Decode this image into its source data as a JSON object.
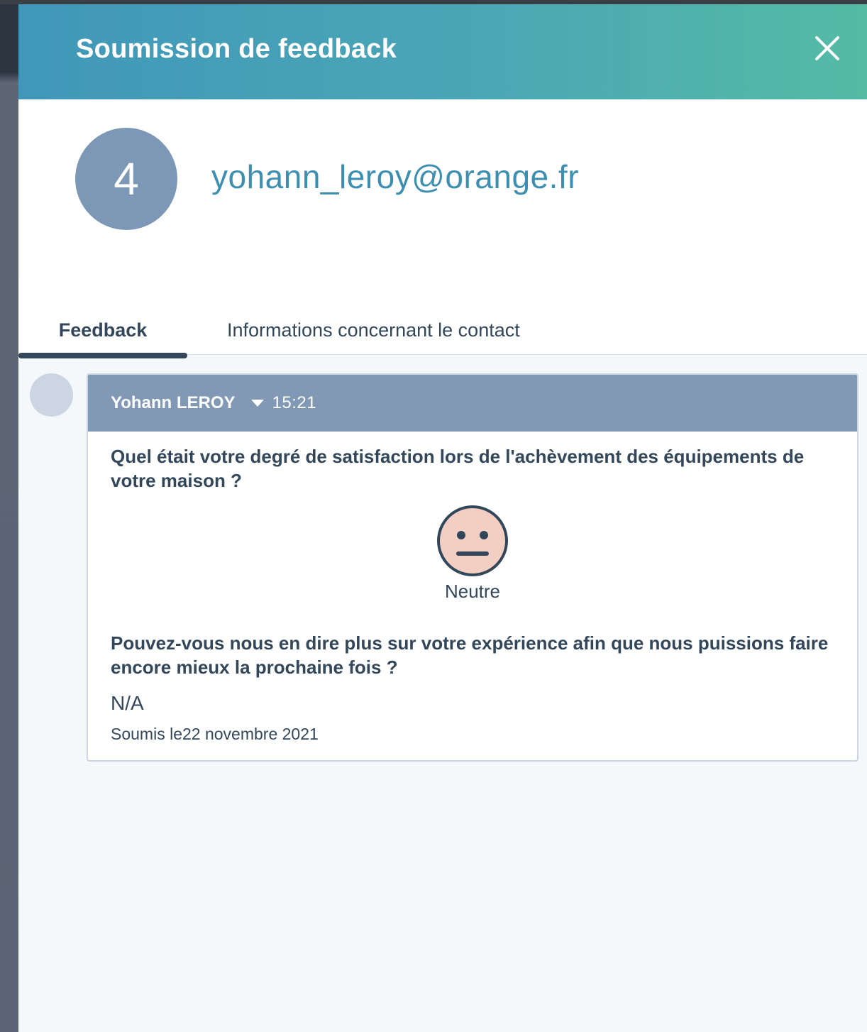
{
  "panel": {
    "title": "Soumission de feedback",
    "close_icon": "close-icon"
  },
  "contact": {
    "avatar_text": "4",
    "email": "yohann_leroy@orange.fr"
  },
  "tabs": [
    {
      "label": "Feedback",
      "active": true
    },
    {
      "label": "Informations concernant le contact",
      "active": false
    }
  ],
  "submission": {
    "author": "Yohann LEROY",
    "time": "15:21",
    "questions": [
      {
        "text": "Quel était votre degré de satisfaction lors de l'achèvement des équipements de votre maison ?",
        "rating_icon": "neutral-face-icon",
        "rating_label": "Neutre"
      },
      {
        "text": "Pouvez-vous nous en dire plus sur votre expérience afin que nous puissions faire encore mieux la prochaine fois ?",
        "answer": "N/A"
      }
    ],
    "submitted": "Soumis le22 novembre 2021"
  },
  "colors": {
    "header_gradient_start": "#4097b9",
    "header_gradient_end": "#55bba4",
    "avatar": "#7c98b6",
    "email": "#3d8fb1",
    "card_header": "#8299b5",
    "face_fill": "#f2cfc2",
    "text": "#33475b"
  }
}
